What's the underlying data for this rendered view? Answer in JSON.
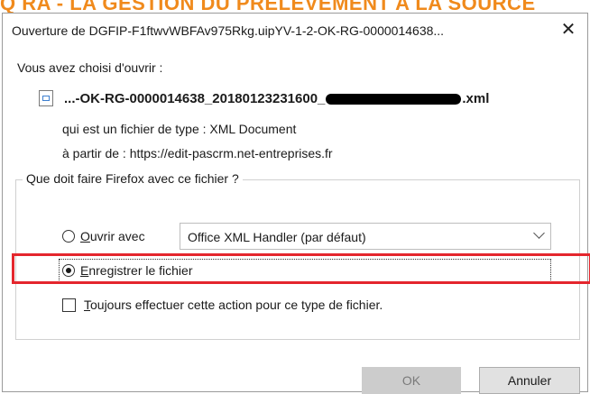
{
  "background": {
    "banner_text": "Q RA - LA GESTION DU PRELEVEMENT A LA SOURCE"
  },
  "dialog": {
    "title": "Ouverture de DGFIP-F1ftwvWBFAv975Rkg.uipYV-1-2-OK-RG-0000014638...",
    "close_glyph": "✕",
    "intro": "Vous avez choisi d'ouvrir :",
    "file": {
      "name_prefix": "...-OK-RG-0000014638_20180123231600_",
      "name_suffix": ".xml",
      "type_line": "qui est un fichier de type : XML Document",
      "source_line": "à partir de : https://edit-pascrm.net-entreprises.fr"
    },
    "group_legend": "Que doit faire Firefox avec ce fichier ?",
    "options": {
      "open_with": {
        "accel": "O",
        "rest": "uvrir avec",
        "checked": false
      },
      "handler_select": {
        "selected": "Office XML Handler (par défaut)"
      },
      "save_file": {
        "accel": "E",
        "rest": "nregistrer le fichier",
        "checked": true
      },
      "always": {
        "accel": "T",
        "rest": "oujours effectuer cette action pour ce type de fichier.",
        "checked": false
      }
    },
    "buttons": {
      "ok": "OK",
      "cancel": "Annuler"
    }
  },
  "colors": {
    "annotation_red": "#e4262d",
    "banner_orange": "#f08a1c"
  },
  "icons": {
    "file": "xml-file-icon",
    "close": "close-icon",
    "dropdown": "chevron-down-icon"
  }
}
